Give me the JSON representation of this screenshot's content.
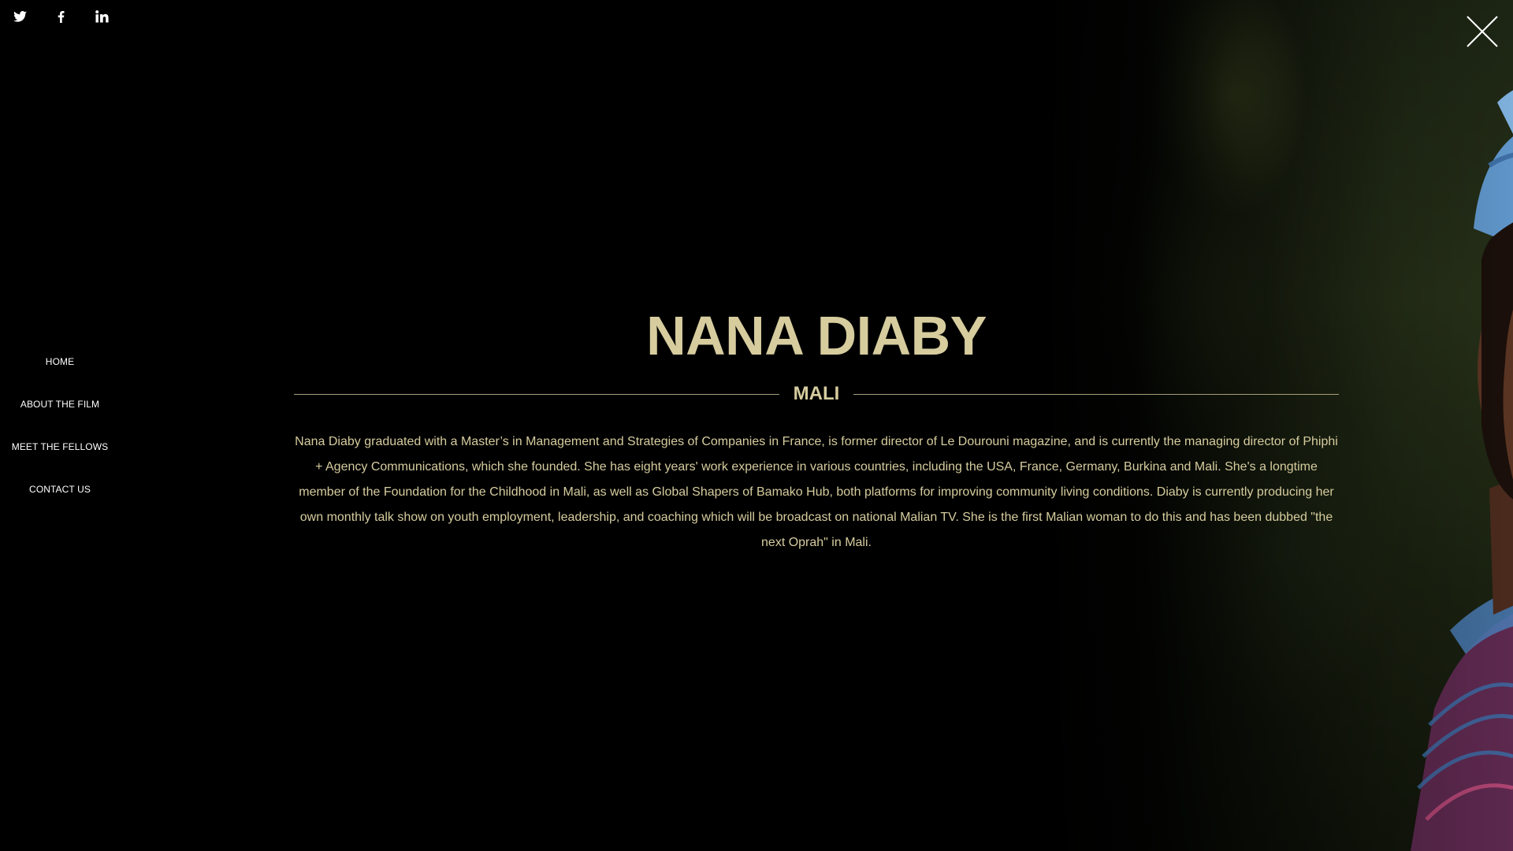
{
  "social": {
    "icons": [
      "twitter-icon",
      "facebook-icon",
      "linkedin-icon"
    ]
  },
  "nav": {
    "items": [
      {
        "label": "HOME"
      },
      {
        "label": "ABOUT THE FILM"
      },
      {
        "label": "MEET THE FELLOWS"
      },
      {
        "label": "CONTACT US"
      }
    ]
  },
  "close_icon": "close-icon",
  "profile": {
    "name": "NANA DIABY",
    "country": "MALI",
    "bio": "Nana Diaby graduated with a Master’s in Management and Strategies of Companies in France, is former director of Le Dourouni magazine, and is currently the managing director of Phiphi + Agency Communications, which she founded. She has eight years' work experience in various countries, including the USA, France, Germany, Burkina and Mali. She's a longtime member of the Foundation for the Childhood in Mali, as well as Global Shapers of Bamako Hub, both platforms for improving community living conditions. Diaby is currently producing her own monthly talk show on youth employment, leadership, and coaching which will be broadcast on national Malian TV. She is the first Malian woman to do this and has been dubbed \"the next Oprah\" in Mali."
  },
  "colors": {
    "background": "#000000",
    "accent_gold": "#d6cc9e",
    "nav_text": "#ffffff"
  }
}
